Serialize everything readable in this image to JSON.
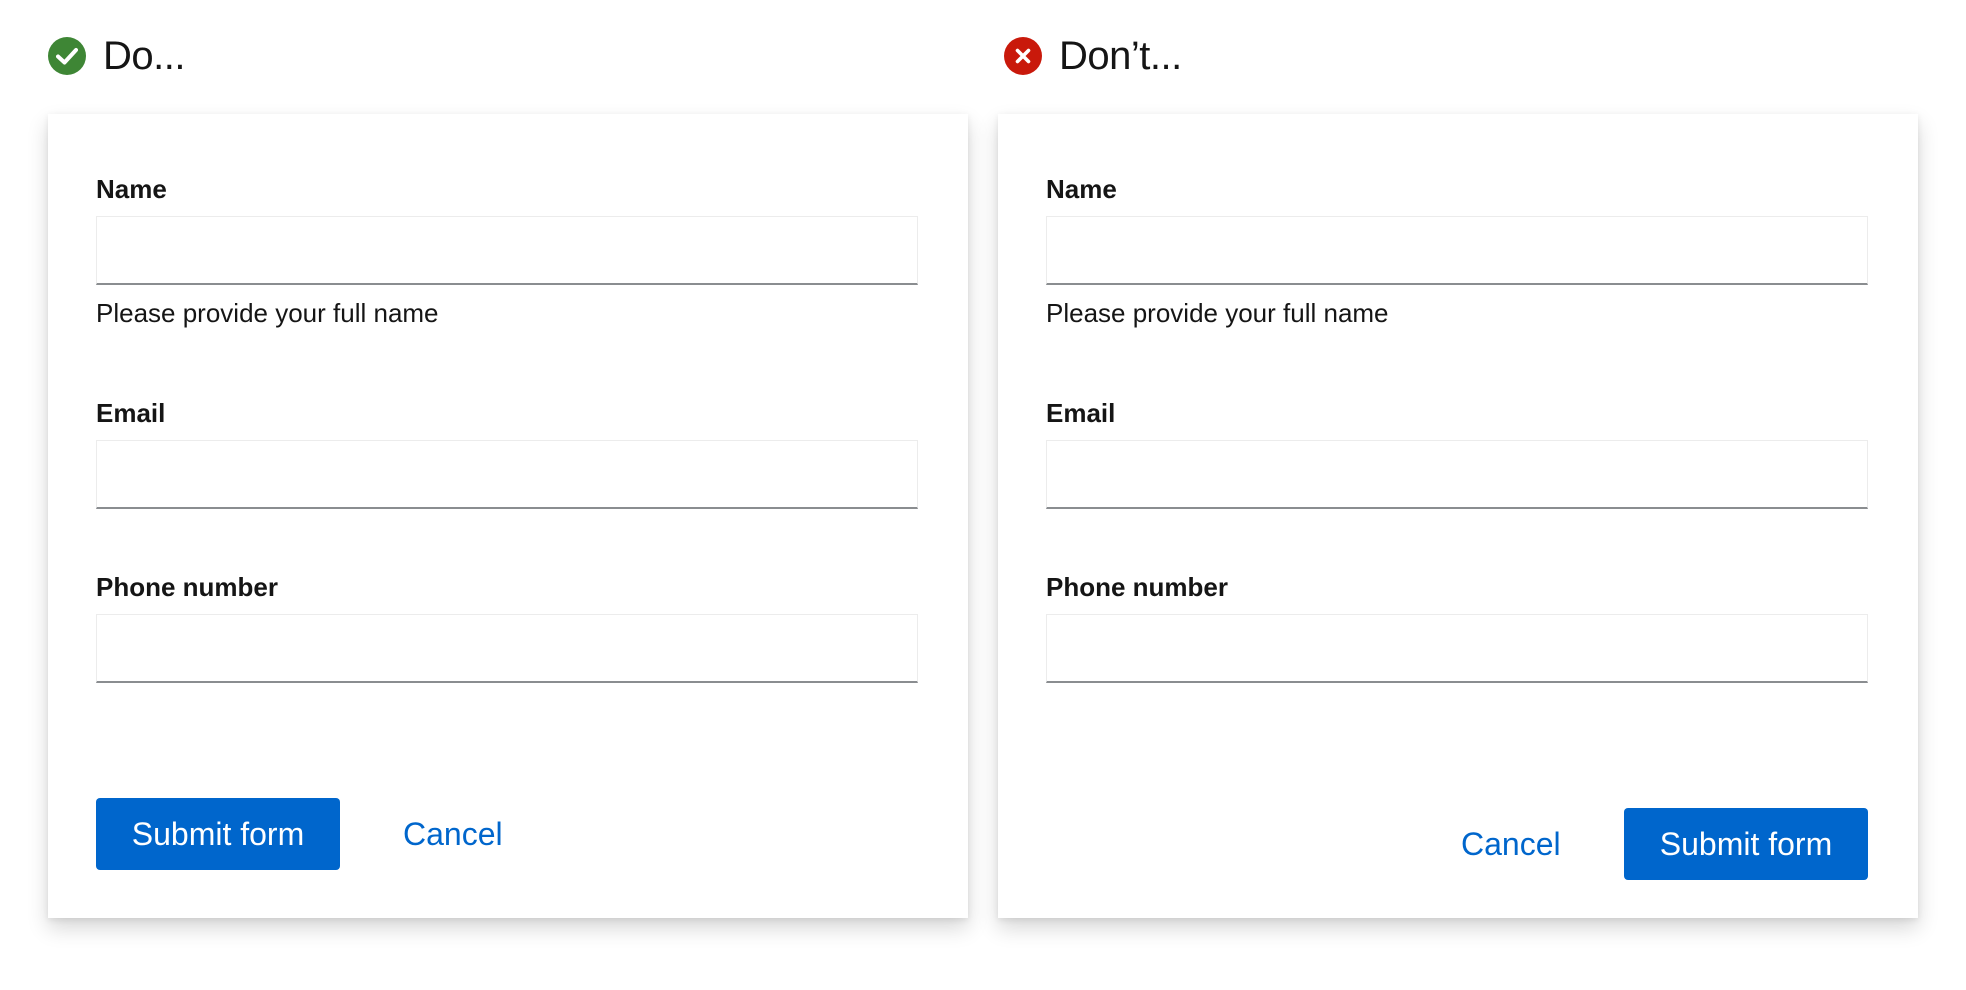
{
  "do_example": {
    "header": "Do...",
    "icon": "check-circle-icon",
    "icon_color": "#3e8635",
    "form": {
      "name_label": "Name",
      "name_helper": "Please provide your full name",
      "email_label": "Email",
      "phone_label": "Phone number",
      "submit_label": "Submit form",
      "cancel_label": "Cancel"
    }
  },
  "dont_example": {
    "header": "Don’t...",
    "icon": "times-circle-icon",
    "icon_color": "#c9190b",
    "form": {
      "name_label": "Name",
      "name_helper": "Please provide your full name",
      "email_label": "Email",
      "phone_label": "Phone number",
      "cancel_label": "Cancel",
      "submit_label": "Submit form"
    }
  },
  "colors": {
    "primary": "#0066cc",
    "success": "#3e8635",
    "danger": "#c9190b"
  }
}
